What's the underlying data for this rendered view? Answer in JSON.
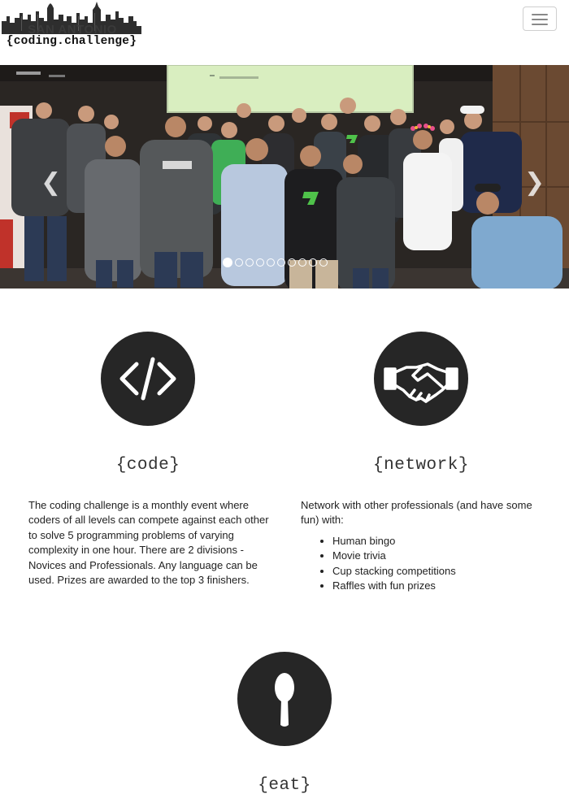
{
  "logo": {
    "city": "SAN ANTONIO",
    "subtitle": "{coding.challenge}"
  },
  "nav": {
    "menu_icon": "hamburger-icon"
  },
  "carousel": {
    "slide_count": 10,
    "active_index": 0,
    "prev_icon": "chevron-left-icon",
    "next_icon": "chevron-right-icon",
    "prev_glyph": "❮",
    "next_glyph": "❯",
    "screen_text": "Jim Locheier"
  },
  "features": {
    "code": {
      "icon": "code-icon",
      "title": "{code}",
      "description": "The coding challenge is a monthly event where coders of all levels can compete against each other to solve 5 programming problems of varying complexity in one hour. There are 2 divisions - Novices and Professionals. Any language can be used. Prizes are awarded to the top 3 finishers."
    },
    "network": {
      "icon": "handshake-icon",
      "title": "{network}",
      "intro": "Network with other professionals (and have some fun) with:",
      "items": [
        "Human bingo",
        "Movie trivia",
        "Cup stacking competitions",
        "Raffles with fun prizes"
      ]
    },
    "eat": {
      "icon": "spoon-icon",
      "title": "{eat}"
    }
  },
  "colors": {
    "icon_circle": "#262626",
    "screen": "#d9eec0",
    "wall_wood": "#6b4a32"
  }
}
